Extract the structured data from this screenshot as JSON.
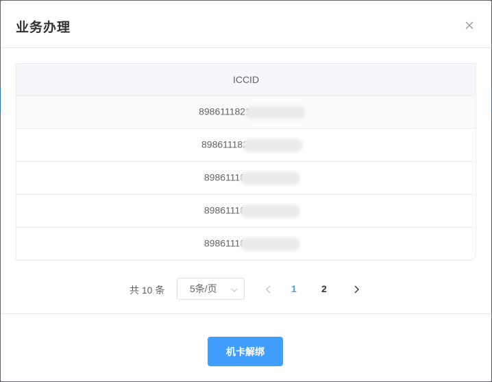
{
  "dialog": {
    "title": "业务办理",
    "close_icon": "close-icon"
  },
  "table": {
    "column_header": "ICCID",
    "rows": [
      {
        "iccid_prefix": "8986111821",
        "masked": true
      },
      {
        "iccid_prefix": "898611182",
        "masked": true
      },
      {
        "iccid_prefix": "89861118",
        "masked": true
      },
      {
        "iccid_prefix": "89861118",
        "masked": true
      },
      {
        "iccid_prefix": "89861118",
        "masked": true
      }
    ]
  },
  "pagination": {
    "total_text": "共 10 条",
    "page_size": "5条/页",
    "pages": [
      "1",
      "2"
    ],
    "current_page": "1",
    "prev_icon": "chevron-left-icon",
    "next_icon": "chevron-right-icon"
  },
  "footer": {
    "primary_button": "机卡解绑"
  },
  "colors": {
    "accent": "#409eff",
    "text": "#606266",
    "title": "#303133",
    "overlay": "#606266"
  }
}
